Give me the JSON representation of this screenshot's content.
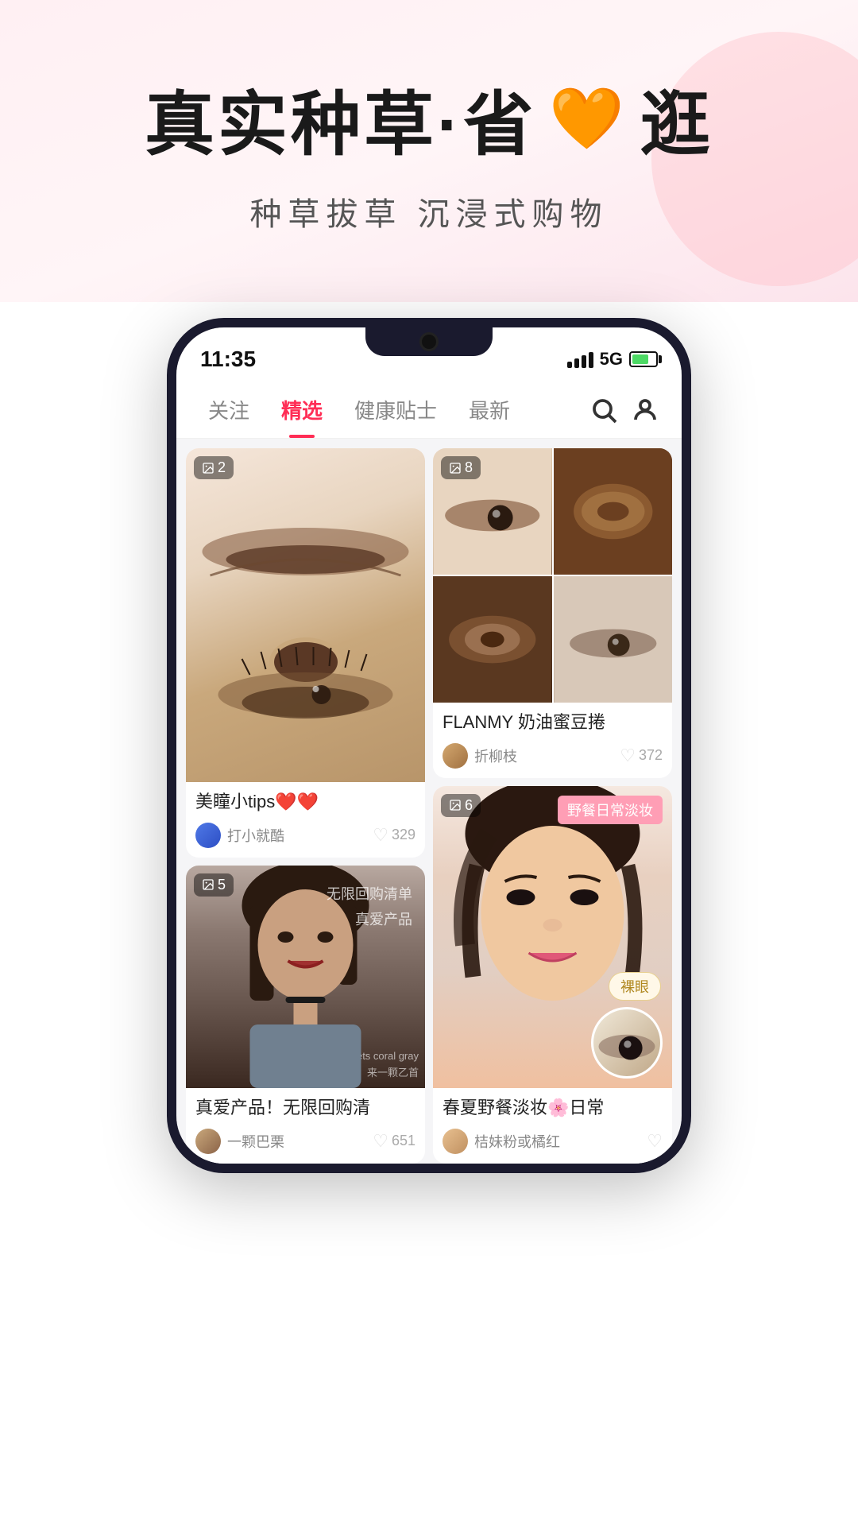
{
  "hero": {
    "title_part1": "真实种草·省",
    "title_part2": "逛",
    "subtitle": "种草拔草  沉浸式购物"
  },
  "phone": {
    "time": "11:35",
    "network": "5G"
  },
  "nav": {
    "tabs": [
      {
        "label": "关注",
        "active": false
      },
      {
        "label": "精选",
        "active": true
      },
      {
        "label": "健康贴士",
        "active": false
      },
      {
        "label": "最新",
        "active": false
      }
    ]
  },
  "cards": [
    {
      "id": "eye-tips",
      "image_count": "2",
      "title": "美瞳小tips❤️❤️",
      "username": "打小就酷",
      "likes": "329"
    },
    {
      "id": "flanmy",
      "image_count": "8",
      "title": "FLANMY 奶油蜜豆捲",
      "username": "折柳枝",
      "likes": "372"
    },
    {
      "id": "repurchase",
      "image_count": "5",
      "title": "真爱产品！无限回购清",
      "overlay_text": "无限回购清单\n真爱产品",
      "username": "一颗巴栗",
      "likes": "651"
    },
    {
      "id": "spring-makeup",
      "image_count": "6",
      "tag": "野餐日常淡妆",
      "title": "春夏野餐淡妆🌸日常",
      "username": "桔妹粉或橘红",
      "likes": ""
    }
  ]
}
